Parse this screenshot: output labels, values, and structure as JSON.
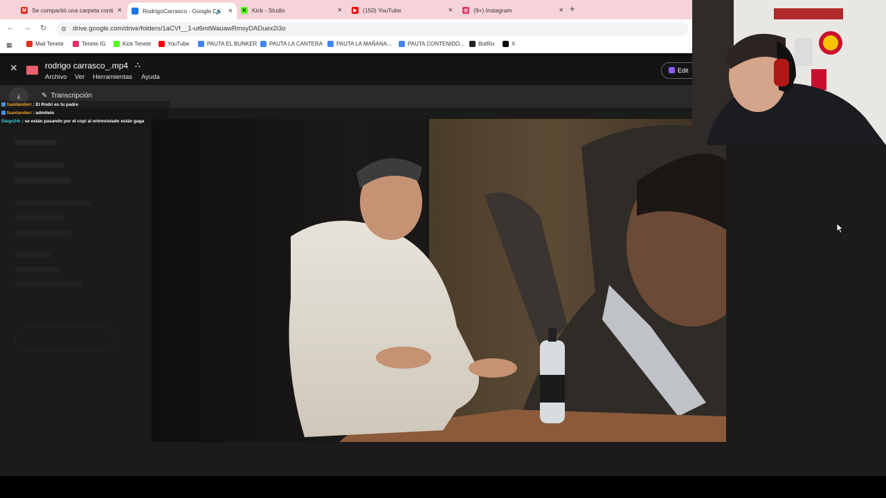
{
  "browser": {
    "tabs": [
      {
        "title": "Se compartió una carpeta conti",
        "icon": "gmail-icon",
        "color": "#d93025"
      },
      {
        "title": "RodrigoCarrasco - Google D",
        "icon": "drive-icon",
        "color": "#1a73e8"
      },
      {
        "title": "Kick - Studio",
        "icon": "kick-icon",
        "color": "#53fc18"
      },
      {
        "title": "(150) YouTube",
        "icon": "youtube-icon",
        "color": "#ff0000"
      },
      {
        "title": "(9+) Instagram",
        "icon": "instagram-icon",
        "color": "#e1306c"
      }
    ],
    "url": "drive.google.com/drive/folders/1aCVf__1-ut6mtWauawRmsyDADuex2i3o",
    "bookmarks": [
      {
        "label": "Mail Tenete",
        "icon": "gmail-icon",
        "color": "#d93025"
      },
      {
        "label": "Tenete IG",
        "icon": "instagram-icon",
        "color": "#e1306c"
      },
      {
        "label": "Kick Tenete",
        "icon": "kick-icon",
        "color": "#53fc18"
      },
      {
        "label": "YouTube",
        "icon": "youtube-icon",
        "color": "#ff0000"
      },
      {
        "label": "PAUTA EL BUNKER",
        "icon": "doc-icon",
        "color": "#4285f4"
      },
      {
        "label": "PAUTA LA CANTERA",
        "icon": "doc-icon",
        "color": "#4285f4"
      },
      {
        "label": "PAUTA LA MAÑANA...",
        "icon": "doc-icon",
        "color": "#4285f4"
      },
      {
        "label": "PAUTA CONTENIDO...",
        "icon": "doc-icon",
        "color": "#4285f4"
      },
      {
        "label": "BotRix",
        "icon": "botrix-icon",
        "color": "#222222"
      },
      {
        "label": "X",
        "icon": "x-icon",
        "color": "#000000"
      }
    ]
  },
  "viewer": {
    "file_name": "rodrigo carrasco_.mp4",
    "menu": [
      "Archivo",
      "Ver",
      "Herramientas",
      "Ayuda"
    ],
    "edit_label": "Edit",
    "transcript_label": "Transcripción"
  },
  "chat": [
    {
      "user": "fsantanderr",
      "message": ": El Rodri es tu padre",
      "user_color": "#f5a623"
    },
    {
      "user": "fsantanderr",
      "message": ": admitelo",
      "user_color": "#f5a623"
    },
    {
      "user": "Diego24r",
      "message": ": se están pasando por el copi al entrevistado están gaga",
      "user_color": "#3fd0d4"
    }
  ]
}
